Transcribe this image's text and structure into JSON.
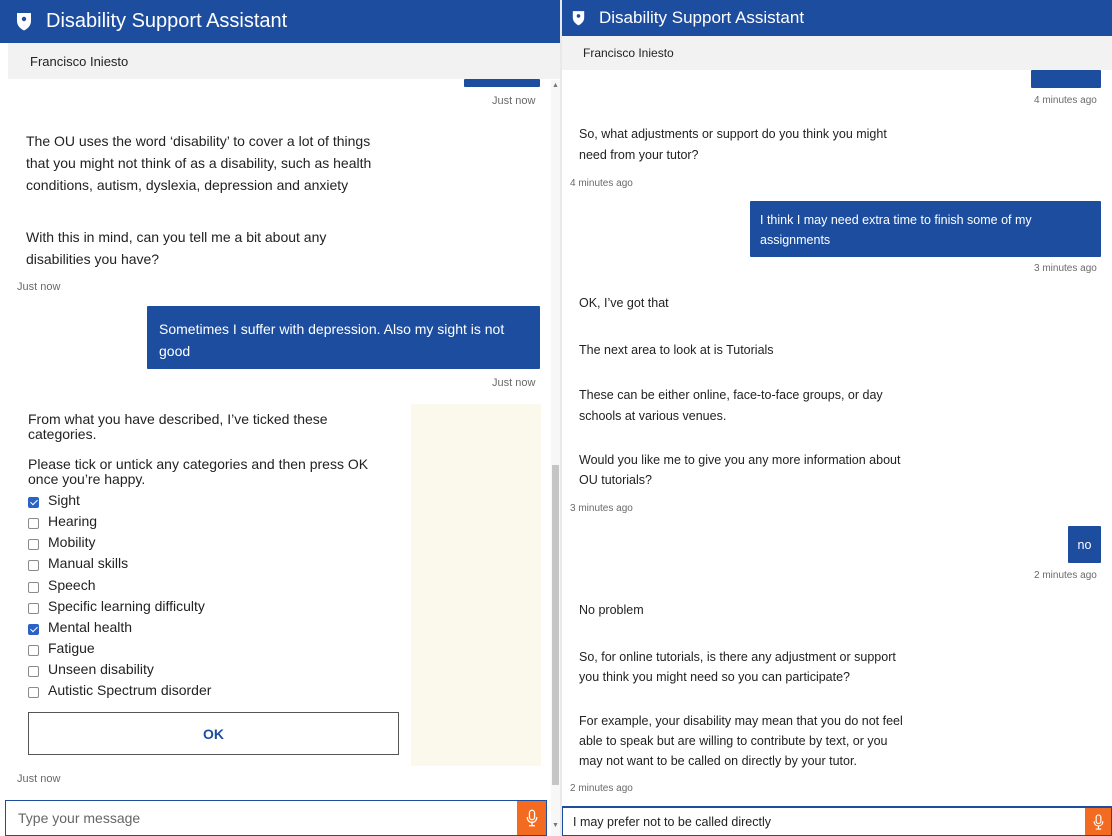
{
  "left": {
    "header": {
      "title": "Disability Support Assistant",
      "user": "Francisco Iniesto"
    },
    "messages": {
      "top_timestamp": "Just now",
      "bot1_line1": "The OU uses the word ‘disability’ to cover a lot of things",
      "bot1_line2": "that you might not think of as a disability, such as health",
      "bot1_line3": "conditions, autism, dyslexia, depression and anxiety",
      "bot2_line1": "With this in mind, can you tell me a bit about any",
      "bot2_line2": "disabilities you have?",
      "bot_timestamp": "Just now",
      "user_line1": "Sometimes I suffer with depression. Also my sight is not",
      "user_line2": "good",
      "user_timestamp": "Just now",
      "form_intro_line1": "From what you have described, I’ve ticked these",
      "form_intro_line2": "categories.",
      "form_instr_line1": "Please tick or untick any categories and then press OK",
      "form_instr_line2": "once you’re happy.",
      "categories": [
        {
          "label": "Sight",
          "checked": true
        },
        {
          "label": "Hearing",
          "checked": false
        },
        {
          "label": "Mobility",
          "checked": false
        },
        {
          "label": "Manual skills",
          "checked": false
        },
        {
          "label": "Speech",
          "checked": false
        },
        {
          "label": "Specific learning difficulty",
          "checked": false
        },
        {
          "label": "Mental health",
          "checked": true
        },
        {
          "label": "Fatigue",
          "checked": false
        },
        {
          "label": "Unseen disability",
          "checked": false
        },
        {
          "label": "Autistic Spectrum disorder",
          "checked": false
        }
      ],
      "ok_label": "OK",
      "form_timestamp": "Just now"
    },
    "input": {
      "placeholder": "Type your message",
      "value": ""
    }
  },
  "right": {
    "header": {
      "title": "Disability Support Assistant",
      "user": "Francisco Iniesto"
    },
    "messages": {
      "top_timestamp": "4 minutes ago",
      "bot1_line1": "So, what adjustments or support do you think you might",
      "bot1_line2": "need from your tutor?",
      "bot1_timestamp": "4 minutes ago",
      "user1_line1": "I think I may need extra time to finish some of my",
      "user1_line2": "assignments",
      "user1_timestamp": "3 minutes ago",
      "bot2_a": "OK, I’ve got that",
      "bot2_b": "The next area to look at is Tutorials",
      "bot2_c1": "These can be either online, face-to-face groups, or day",
      "bot2_c2": "schools at various venues.",
      "bot2_d1": "Would you like me to give you any more information about",
      "bot2_d2": "OU tutorials?",
      "bot2_timestamp": "3 minutes ago",
      "user2": "no",
      "user2_timestamp": "2 minutes ago",
      "bot3_a": "No problem",
      "bot3_b1": "So, for online tutorials, is there any adjustment or support",
      "bot3_b2": "you think you might need so you can participate?",
      "bot3_c1": "For example, your disability may mean that you do not feel",
      "bot3_c2": "able to speak but are willing to contribute by text, or you",
      "bot3_c3": "may not want to be called on directly by your tutor.",
      "bot3_timestamp": "2 minutes ago"
    },
    "input": {
      "placeholder": "Type your message",
      "value": "I may prefer not to be called directly"
    }
  },
  "colors": {
    "brand_blue": "#1d4d9f",
    "mic_orange": "#f26b21",
    "checkbox_blue": "#2a63c4",
    "form_side_panel": "#fbf9ec"
  },
  "icons": {
    "header": "shield-icon",
    "mic": "microphone-icon"
  }
}
